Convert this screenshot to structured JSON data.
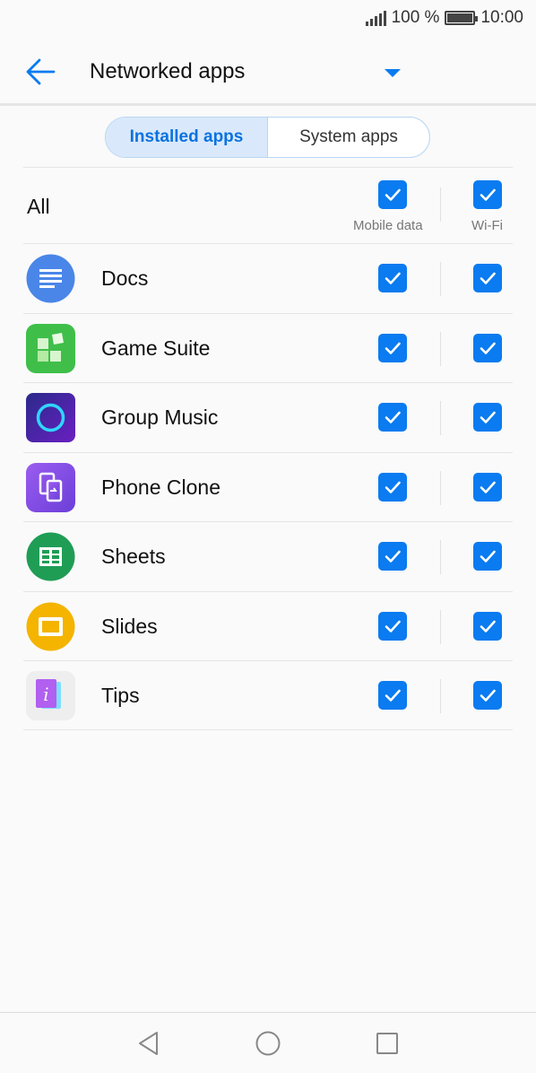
{
  "status": {
    "battery_percent": "100 %",
    "time": "10:00"
  },
  "header": {
    "title": "Networked apps"
  },
  "tabs": [
    {
      "label": "Installed apps",
      "active": true
    },
    {
      "label": "System apps",
      "active": false
    }
  ],
  "columns": {
    "mobile_data": "Mobile data",
    "wifi": "Wi-Fi"
  },
  "all_row": {
    "label": "All",
    "mobile_data_checked": true,
    "wifi_checked": true
  },
  "apps": [
    {
      "name": "Docs",
      "icon": "docs-icon",
      "mobile_data_checked": true,
      "wifi_checked": true
    },
    {
      "name": "Game Suite",
      "icon": "game-suite-icon",
      "mobile_data_checked": true,
      "wifi_checked": true
    },
    {
      "name": "Group Music",
      "icon": "group-music-icon",
      "mobile_data_checked": true,
      "wifi_checked": true
    },
    {
      "name": "Phone Clone",
      "icon": "phone-clone-icon",
      "mobile_data_checked": true,
      "wifi_checked": true
    },
    {
      "name": "Sheets",
      "icon": "sheets-icon",
      "mobile_data_checked": true,
      "wifi_checked": true
    },
    {
      "name": "Slides",
      "icon": "slides-icon",
      "mobile_data_checked": true,
      "wifi_checked": true
    },
    {
      "name": "Tips",
      "icon": "tips-icon",
      "mobile_data_checked": true,
      "wifi_checked": true
    }
  ],
  "colors": {
    "accent": "#0a7bf0",
    "tab_active_text": "#0a72e0",
    "tab_active_bg": "#d9e9fb"
  }
}
